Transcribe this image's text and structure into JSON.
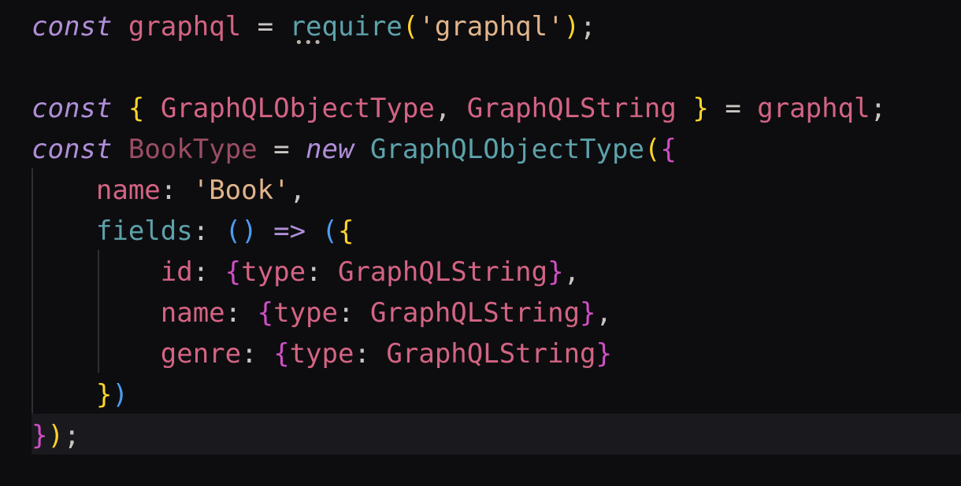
{
  "colors": {
    "background": "#0d0d10",
    "current_line": "#1a1a1e",
    "indent_guide": "#2e2e34",
    "keyword": "#b08ed8",
    "identifier": "#d46483",
    "dim_identifier": "#9a4d62",
    "function": "#5da2aa",
    "string": "#e2b48a",
    "punctuation": "#c9c6c2",
    "operator": "#c9c6c2",
    "bracket_yellow": "#ffd42a",
    "bracket_magenta": "#d04fc4",
    "bracket_blue": "#4d9cf2",
    "hint_dots": "#b8b2a8"
  },
  "hint": {
    "text": "•••"
  },
  "lines": [
    {
      "id": "line-1",
      "tokens": [
        {
          "t": "const",
          "c": "keyword",
          "i": true
        },
        {
          "t": " ",
          "c": "punctuation"
        },
        {
          "t": "graphql",
          "c": "identifier"
        },
        {
          "t": " = ",
          "c": "operator"
        },
        {
          "t": "require",
          "c": "function"
        },
        {
          "t": "(",
          "c": "bracket_yellow"
        },
        {
          "t": "'graphql'",
          "c": "string"
        },
        {
          "t": ")",
          "c": "bracket_yellow"
        },
        {
          "t": ";",
          "c": "punctuation"
        }
      ]
    },
    {
      "id": "line-2",
      "tokens": []
    },
    {
      "id": "line-3",
      "tokens": [
        {
          "t": "const",
          "c": "keyword",
          "i": true
        },
        {
          "t": " ",
          "c": "punctuation"
        },
        {
          "t": "{",
          "c": "bracket_yellow"
        },
        {
          "t": " ",
          "c": "punctuation"
        },
        {
          "t": "GraphQLObjectType",
          "c": "identifier"
        },
        {
          "t": ", ",
          "c": "punctuation"
        },
        {
          "t": "GraphQLString",
          "c": "identifier"
        },
        {
          "t": " ",
          "c": "punctuation"
        },
        {
          "t": "}",
          "c": "bracket_yellow"
        },
        {
          "t": " = ",
          "c": "operator"
        },
        {
          "t": "graphql",
          "c": "identifier"
        },
        {
          "t": ";",
          "c": "punctuation"
        }
      ]
    },
    {
      "id": "line-4",
      "tokens": [
        {
          "t": "const",
          "c": "keyword",
          "i": true
        },
        {
          "t": " ",
          "c": "punctuation"
        },
        {
          "t": "BookType",
          "c": "dim_identifier"
        },
        {
          "t": " = ",
          "c": "operator"
        },
        {
          "t": "new",
          "c": "keyword",
          "i": true
        },
        {
          "t": " ",
          "c": "punctuation"
        },
        {
          "t": "GraphQLObjectType",
          "c": "function"
        },
        {
          "t": "(",
          "c": "bracket_yellow"
        },
        {
          "t": "{",
          "c": "bracket_magenta"
        }
      ]
    },
    {
      "id": "line-5",
      "tokens": [
        {
          "t": "    ",
          "c": "punctuation"
        },
        {
          "t": "name",
          "c": "identifier"
        },
        {
          "t": ": ",
          "c": "punctuation"
        },
        {
          "t": "'Book'",
          "c": "string"
        },
        {
          "t": ",",
          "c": "punctuation"
        }
      ]
    },
    {
      "id": "line-6",
      "tokens": [
        {
          "t": "    ",
          "c": "punctuation"
        },
        {
          "t": "fields",
          "c": "function"
        },
        {
          "t": ": ",
          "c": "punctuation"
        },
        {
          "t": "()",
          "c": "bracket_blue"
        },
        {
          "t": " ",
          "c": "punctuation"
        },
        {
          "t": "=>",
          "c": "keyword"
        },
        {
          "t": " ",
          "c": "punctuation"
        },
        {
          "t": "(",
          "c": "bracket_blue"
        },
        {
          "t": "{",
          "c": "bracket_yellow"
        }
      ]
    },
    {
      "id": "line-7",
      "tokens": [
        {
          "t": "        ",
          "c": "punctuation"
        },
        {
          "t": "id",
          "c": "identifier"
        },
        {
          "t": ": ",
          "c": "punctuation"
        },
        {
          "t": "{",
          "c": "bracket_magenta"
        },
        {
          "t": "type",
          "c": "identifier"
        },
        {
          "t": ": ",
          "c": "punctuation"
        },
        {
          "t": "GraphQLString",
          "c": "identifier"
        },
        {
          "t": "}",
          "c": "bracket_magenta"
        },
        {
          "t": ",",
          "c": "punctuation"
        }
      ]
    },
    {
      "id": "line-8",
      "tokens": [
        {
          "t": "        ",
          "c": "punctuation"
        },
        {
          "t": "name",
          "c": "identifier"
        },
        {
          "t": ": ",
          "c": "punctuation"
        },
        {
          "t": "{",
          "c": "bracket_magenta"
        },
        {
          "t": "type",
          "c": "identifier"
        },
        {
          "t": ": ",
          "c": "punctuation"
        },
        {
          "t": "GraphQLString",
          "c": "identifier"
        },
        {
          "t": "}",
          "c": "bracket_magenta"
        },
        {
          "t": ",",
          "c": "punctuation"
        }
      ]
    },
    {
      "id": "line-9",
      "tokens": [
        {
          "t": "        ",
          "c": "punctuation"
        },
        {
          "t": "genre",
          "c": "identifier"
        },
        {
          "t": ": ",
          "c": "punctuation"
        },
        {
          "t": "{",
          "c": "bracket_magenta"
        },
        {
          "t": "type",
          "c": "identifier"
        },
        {
          "t": ": ",
          "c": "punctuation"
        },
        {
          "t": "GraphQLString",
          "c": "identifier"
        },
        {
          "t": "}",
          "c": "bracket_magenta"
        }
      ]
    },
    {
      "id": "line-10",
      "tokens": [
        {
          "t": "    ",
          "c": "punctuation"
        },
        {
          "t": "}",
          "c": "bracket_yellow"
        },
        {
          "t": ")",
          "c": "bracket_blue"
        }
      ]
    },
    {
      "id": "line-11",
      "tokens": [
        {
          "t": "}",
          "c": "bracket_magenta"
        },
        {
          "t": ")",
          "c": "bracket_yellow"
        },
        {
          "t": ";",
          "c": "punctuation"
        }
      ]
    }
  ]
}
